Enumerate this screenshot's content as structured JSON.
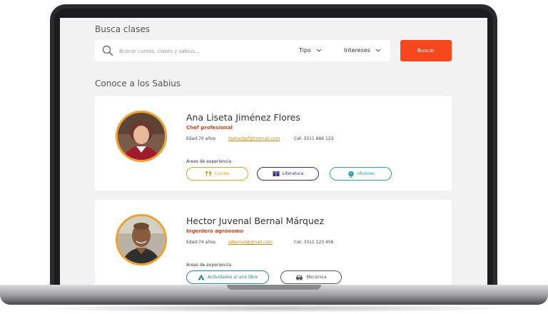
{
  "search": {
    "title": "Busca clases",
    "placeholder": "Buscar cursos, clases y sabius...",
    "filter_tipo": "Tipo",
    "filter_intereses": "Intereses",
    "button_label": "Buscar"
  },
  "section": {
    "title": "Conoce a los Sabius"
  },
  "sabius": [
    {
      "name": "Ana Liseta Jiménez Flores",
      "profession": "Chef profesional",
      "age": "Edad:70 años",
      "email": "lisetachef@hotmail.com",
      "phone": "Cel: 3311 666 123",
      "areas_label": "Áreas de experiencia",
      "tags": [
        {
          "label": "Cocina",
          "icon": "utensils-icon",
          "color": "#e8a020"
        },
        {
          "label": "Literatura",
          "icon": "book-icon",
          "color": "#3d2a7a"
        },
        {
          "label": "Idiomas",
          "icon": "globe-icon",
          "color": "#2aa0b0"
        }
      ]
    },
    {
      "name": "Hector Juvenal Bernal Márquez",
      "profession": "Ingeniero agrónomo",
      "age": "Edad:74 años",
      "email": "jubernal@gmail.com",
      "phone": "Cel: 3311 123 456",
      "areas_label": "Áreas de experiencia",
      "tags": [
        {
          "label": "Actividades al aire libre",
          "icon": "tent-icon",
          "color": "#1f8a8a"
        },
        {
          "label": "Mecánica",
          "icon": "car-icon",
          "color": "#555555"
        }
      ]
    }
  ],
  "colors": {
    "accent": "#f5481f",
    "avatar_ring": "#f0a030",
    "background": "#f2f2f2"
  }
}
